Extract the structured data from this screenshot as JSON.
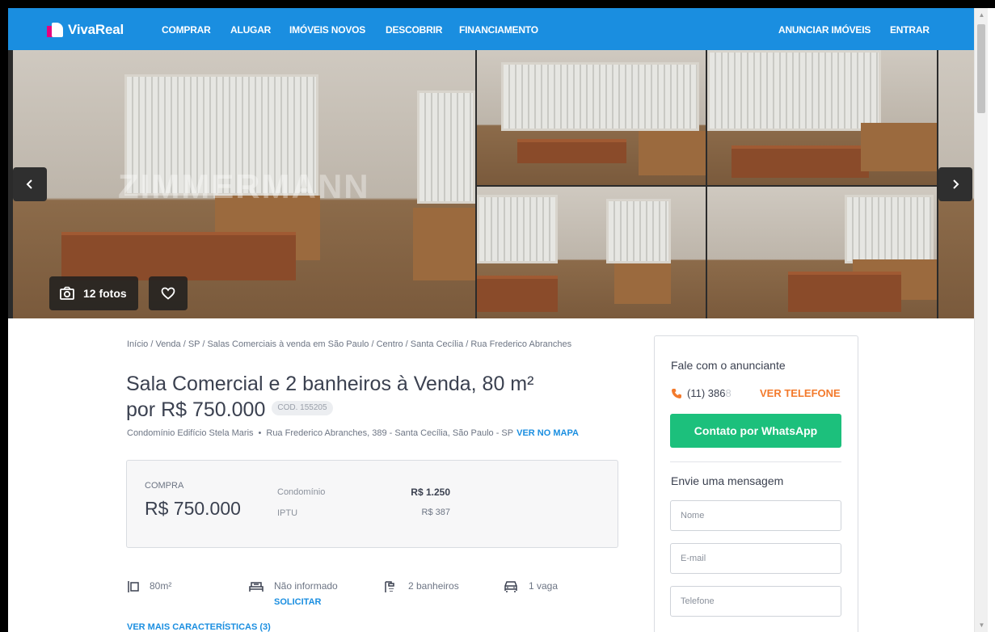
{
  "header": {
    "logo_text": "VivaReal",
    "nav": [
      {
        "label": "COMPRAR"
      },
      {
        "label": "ALUGAR"
      },
      {
        "label": "IMÓVEIS NOVOS"
      },
      {
        "label": "DESCOBRIR"
      },
      {
        "label": "FINANCIAMENTO"
      }
    ],
    "right_nav": [
      {
        "label": "ANUNCIAR IMÓVEIS"
      },
      {
        "label": "ENTRAR"
      }
    ]
  },
  "gallery": {
    "photos_label": "12 fotos",
    "watermark": "ZIMMERMANN",
    "prev_icon": "chevron-left-icon",
    "next_icon": "chevron-right-icon"
  },
  "listing": {
    "breadcrumb": "Início / Venda / SP / Salas Comerciais à venda em São Paulo / Centro / Santa Cecília / Rua Frederico Abranches",
    "title_line1": "Sala Comercial e 2 banheiros à Venda, 80 m²",
    "title_line2": "por R$ 750.000",
    "code": "COD. 155205",
    "condo_name": "Condomínio Edifício Stela Maris",
    "separator": "•",
    "address": "Rua Frederico Abranches, 389 - Santa Cecília, São Paulo - SP",
    "map_link": "VER NO MAPA"
  },
  "pricing": {
    "label": "COMPRA",
    "price": "R$ 750.000",
    "condo_label": "Condomínio",
    "condo_value": "R$ 1.250",
    "iptu_label": "IPTU",
    "iptu_value": "R$ 387"
  },
  "features": {
    "area": "80m²",
    "rooms": "Não informado",
    "rooms_action": "SOLICITAR",
    "bathrooms": "2 banheiros",
    "parking": "1 vaga",
    "more_link": "VER MAIS CARACTERÍSTICAS (3)"
  },
  "contact": {
    "title": "Fale com o anunciante",
    "phone_visible": "(11) 386",
    "phone_faded": "8",
    "show_phone": "VER TELEFONE",
    "whatsapp": "Contato por WhatsApp",
    "message_title": "Envie uma mensagem",
    "name_placeholder": "Nome",
    "email_placeholder": "E-mail",
    "phone_placeholder": "Telefone"
  },
  "colors": {
    "brand_blue": "#1a8ee0",
    "whatsapp_green": "#1cc07c",
    "accent_orange": "#f37a2c",
    "logo_pink": "#e6007e"
  }
}
